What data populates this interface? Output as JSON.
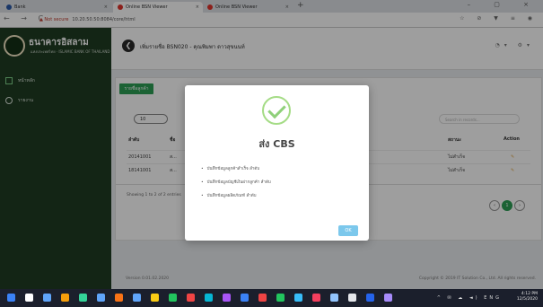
{
  "browser": {
    "tabs": [
      {
        "label": "Bank",
        "close": "×"
      },
      {
        "label": "Online BSN Viewer",
        "close": "×"
      },
      {
        "label": "Online BSN Viewer",
        "close": "×"
      }
    ],
    "new_tab": "+",
    "window_controls": "– ▢ ×",
    "nav": "← → C",
    "url_warning": "▲ Not secure",
    "url": "10.20.50.50:8084/core/html",
    "ext_icons": "☆ ⊘ ▼ ≡ ◉"
  },
  "sidebar": {
    "bank_name": "ธนาคารอิสลาม",
    "bank_sub": "แห่งประเทศไทย · ISLAMIC BANK OF THAILAND",
    "items": [
      {
        "label": "หน้าหลัก",
        "icon": "square-icon"
      },
      {
        "label": "รายงาน",
        "icon": "globe-icon"
      }
    ]
  },
  "header": {
    "back": "❮",
    "title": "เพิ่มรายชื่อ  BSN020 - คุณพิมพา ดาวสุขนนท์",
    "icons": "◔▾ ⚙▾"
  },
  "content": {
    "tab": "รายชื่อลูกค้า",
    "page_size": "10",
    "search_placeholder": "Search in records...",
    "columns": [
      "ลำดับ",
      "ชื่อ",
      "สถานะ",
      "Action"
    ],
    "rows": [
      {
        "id": "20141001",
        "name": "ส...",
        "status": "ไม่สำเร็จ",
        "action": "✎"
      },
      {
        "id": "18141001",
        "name": "ส...",
        "status": "ไม่สำเร็จ",
        "action": "✎"
      }
    ],
    "info": "Showing 1 to 2 of 2 entries",
    "pager": [
      "‹",
      "1",
      "›"
    ]
  },
  "footer": {
    "version": "Version 0.01.02.2020",
    "copyright": "Copyright © 2019 IT Solution Co., Ltd. All rights reserved."
  },
  "modal": {
    "title": "ส่ง CBS",
    "messages": [
      "บันทึกข้อมูลลูกค้าสำเร็จ ลำดับ",
      "บันทึกข้อมูลบัญชีเงินฝากลูกค้า ลำดับ",
      "บันทึกข้อมูลผลิตภัณฑ์ ลำดับ"
    ],
    "ok": "OK"
  },
  "taskbar": {
    "time": "4:12 PM",
    "date": "12/5/2020",
    "tray_icons": "^ ✉ ☁ ◄) ENG",
    "icon_colors": [
      "#3b82f6",
      "#ffffff",
      "#60a5fa",
      "#f59e0b",
      "#34d399",
      "#60a5fa",
      "#f97316",
      "#60a5fa",
      "#facc15",
      "#22c55e",
      "#ef4444",
      "#06b6d4",
      "#a855f7",
      "#3b82f6",
      "#ef4444",
      "#22c55e",
      "#38bdf8",
      "#f43f5e",
      "#93c5fd",
      "#e5e7eb",
      "#2563eb",
      "#a78bfa"
    ]
  }
}
